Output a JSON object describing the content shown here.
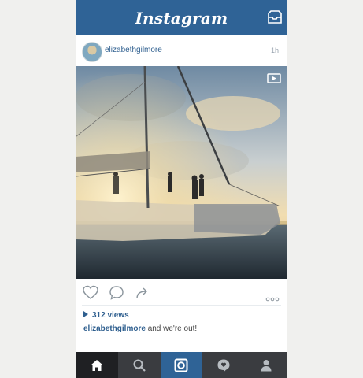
{
  "app": {
    "title": "Instagram"
  },
  "post": {
    "username": "elizabethgilmore",
    "time": "1h",
    "views": "312 views",
    "caption_user": "elizabethgilmore",
    "caption_text": "and we're out!"
  },
  "icons": {
    "inbox": "inbox-icon",
    "video": "video-camera-icon",
    "like": "heart-icon",
    "comment": "comment-icon",
    "share": "share-icon",
    "more": "more-icon",
    "home": "home-icon",
    "search": "search-icon",
    "camera": "camera-icon",
    "activity": "activity-icon",
    "profile": "profile-icon"
  },
  "colors": {
    "brand": "#2f6396",
    "link": "#2f5f8f",
    "tabbar": "#3a3c40"
  }
}
